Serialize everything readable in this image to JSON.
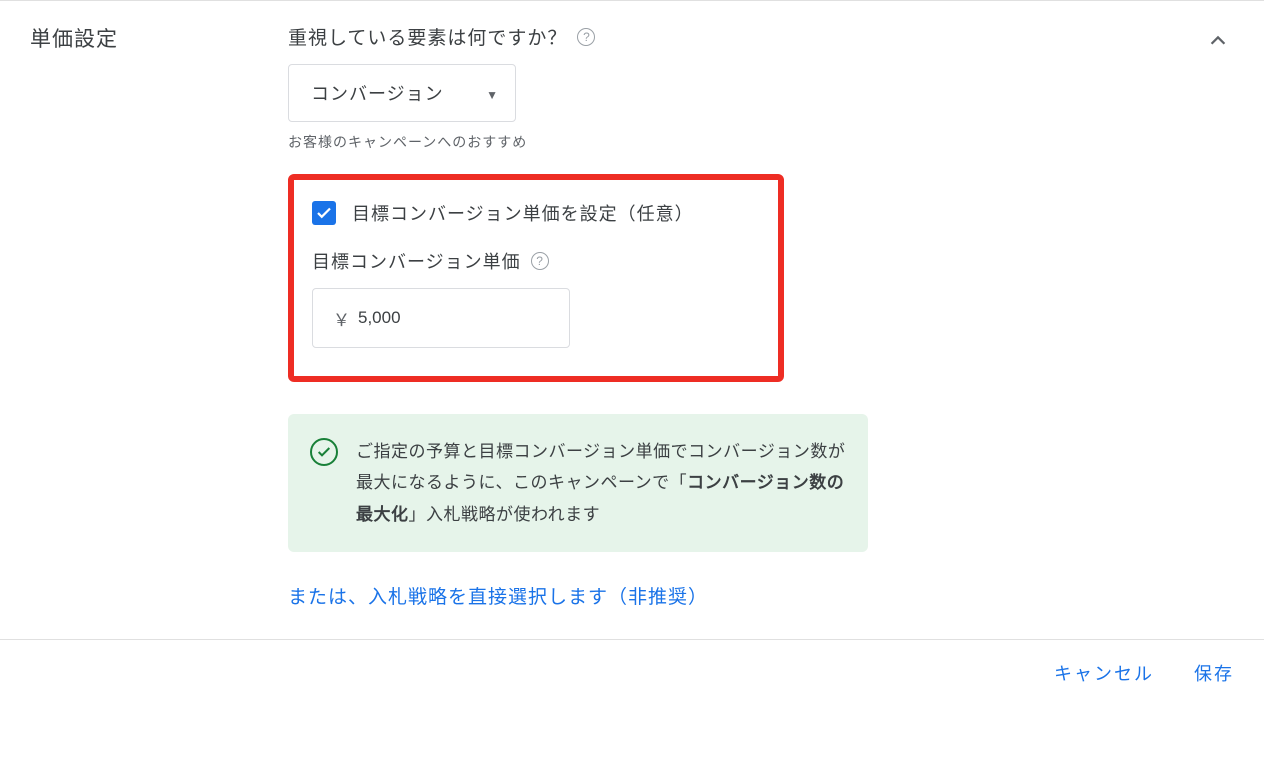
{
  "section_title": "単価設定",
  "question": "重視している要素は何ですか？",
  "dropdown": {
    "selected": "コンバージョン"
  },
  "recommendation_note": "お客様のキャンペーンへのおすすめ",
  "target_cpa": {
    "checkbox_label": "目標コンバージョン単価を設定（任意）",
    "field_label": "目標コンバージョン単価",
    "currency_symbol": "￥",
    "value": "5,000"
  },
  "info": {
    "pre": "ご指定の予算と目標コンバージョン単価でコンバージョン数が最大になるように、このキャンペーンで「",
    "bold": "コンバージョン数の最大化",
    "post": "」入札戦略が使われます"
  },
  "alt_link": "または、入札戦略を直接選択します（非推奨）",
  "footer": {
    "cancel": "キャンセル",
    "save": "保存"
  }
}
